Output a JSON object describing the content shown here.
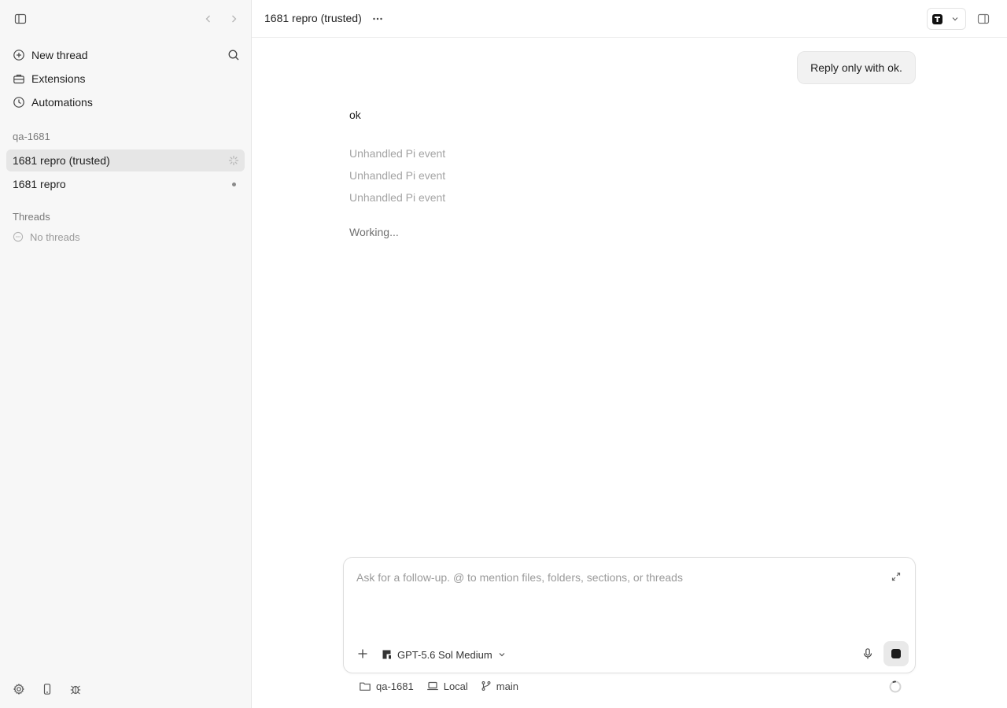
{
  "sidebar": {
    "nav": [
      {
        "label": "New thread",
        "icon": "plus-circle-icon"
      },
      {
        "label": "Extensions",
        "icon": "toolbox-icon"
      },
      {
        "label": "Automations",
        "icon": "clock-icon"
      }
    ],
    "project_label": "qa-1681",
    "threads": [
      {
        "label": "1681 repro (trusted)",
        "status": "loading",
        "active": true
      },
      {
        "label": "1681 repro",
        "status": "dot",
        "active": false
      }
    ],
    "threads_section_label": "Threads",
    "no_threads_label": "No threads"
  },
  "header": {
    "title": "1681 repro (trusted)"
  },
  "conversation": {
    "user_message": "Reply only with ok.",
    "assistant_reply": "ok",
    "events": [
      "Unhandled Pi event",
      "Unhandled Pi event",
      "Unhandled Pi event"
    ],
    "status": "Working..."
  },
  "composer": {
    "placeholder": "Ask for a follow-up. @ to mention files, folders, sections, or threads",
    "value": "",
    "model_label": "GPT-5.6 Sol Medium"
  },
  "footer": {
    "folder": "qa-1681",
    "environment": "Local",
    "branch": "main"
  },
  "colors": {
    "sidebar_bg": "#f7f7f7",
    "active_thread_bg": "#e6e6e6",
    "muted_text": "#a3a3a3"
  }
}
